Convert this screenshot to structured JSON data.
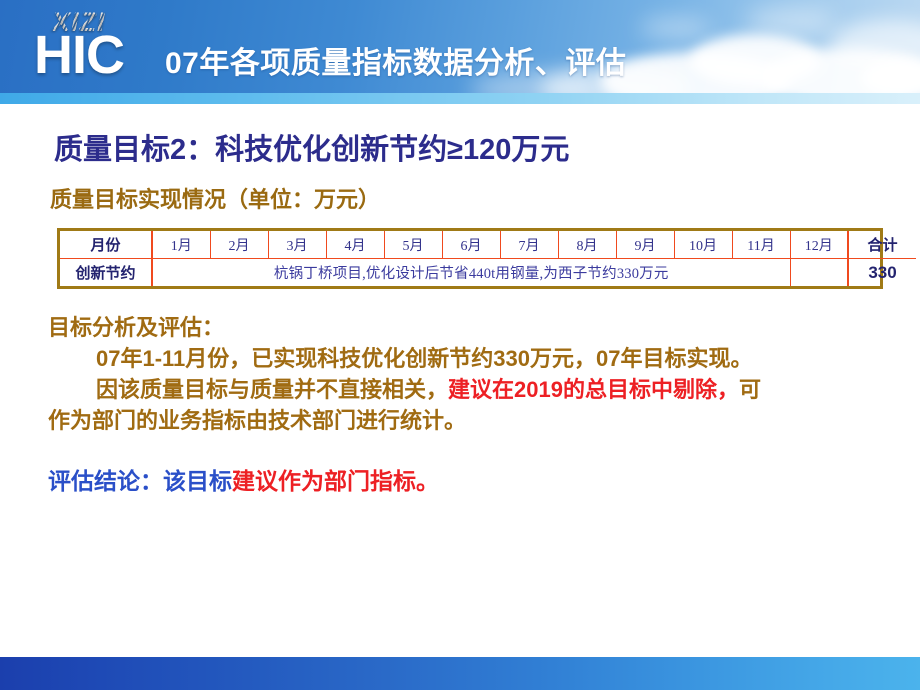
{
  "banner": {
    "logo_top": "XIZI",
    "logo_bottom": "HIC",
    "title": "07年各项质量指标数据分析、评估"
  },
  "slide": {
    "goal_title": "质量目标2：科技优化创新节约≥120万元",
    "goal_subtitle": "质量目标实现情况（单位：万元）"
  },
  "table": {
    "row_header_label": "月份",
    "months": [
      "1月",
      "2月",
      "3月",
      "4月",
      "5月",
      "6月",
      "7月",
      "8月",
      "9月",
      "10月",
      "11月",
      "12月"
    ],
    "total_label": "合计",
    "row2_label": "创新节约",
    "row2_merged_text": "杭锅丁桥项目,优化设计后节省440t用钢量,为西子节约330万元",
    "row2_dec": "",
    "row2_total": "330"
  },
  "analysis": {
    "heading": "目标分析及评估：",
    "line1": "07年1-11月份，已实现科技优化创新节约330万元，07年目标实现。",
    "line2_a": "因该质量目标与质量并不直接相关，",
    "line2_red": "建议在2019的总目标中剔除，",
    "line2_b": "可",
    "line3": "作为部门的业务指标由技术部门进行统计。"
  },
  "conclusion": {
    "blue_part": "评估结论：该目标",
    "red_part": "建议作为部门指标。"
  },
  "colors": {
    "goal_title": "#2c2c8c",
    "goal_subtitle": "#9a6a11",
    "analysis": "#a06b12",
    "highlight_red": "#ed2024",
    "conclusion_blue": "#2a4fc8",
    "table_outer_border": "#a07a16",
    "table_inner_border": "#f04a1e",
    "banner_blue": "#2f7ac9"
  }
}
